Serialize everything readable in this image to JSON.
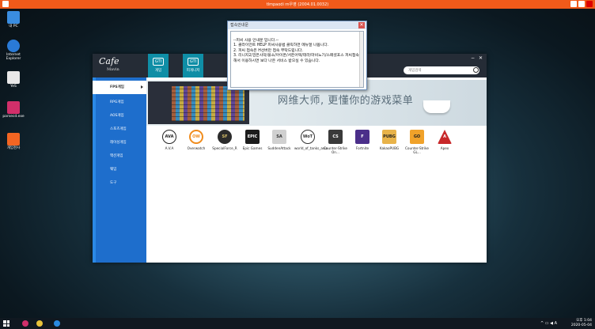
{
  "window_title": "tlmpaodi rn우영 (2004.01.0032)",
  "desktop": {
    "icons": [
      {
        "label": "내 PC",
        "color": "#3a8de0"
      },
      {
        "label": "Internet Explorer",
        "color": "#2a7ad6"
      },
      {
        "label": "YeS",
        "color": "#e8e8e8"
      },
      {
        "label": "parsecd.exe",
        "color": "#d12f6a"
      },
      {
        "label": "개임천사",
        "color": "#f26522"
      }
    ]
  },
  "app": {
    "logo_main": "Cafe",
    "logo_sub": "Mavin",
    "tabs": [
      {
        "icon": "GTI",
        "label": "게임"
      },
      {
        "icon": "GTI",
        "label": "피게니저"
      }
    ],
    "search_placeholder": "게임검색",
    "sidebar": [
      {
        "label": "FPS게임",
        "active": true
      },
      {
        "label": "RPG게임",
        "active": false
      },
      {
        "label": "AOS게임",
        "active": false
      },
      {
        "label": "스포츠게임",
        "active": false
      },
      {
        "label": "레이싱게임",
        "active": false
      },
      {
        "label": "액션게임",
        "active": false
      },
      {
        "label": "웨임",
        "active": false
      },
      {
        "label": "도구",
        "active": false
      }
    ],
    "banner_text": "网维大师, 更懂你的游戏菜单",
    "games": [
      {
        "label": "A.V.A",
        "icon_text": "AVA",
        "color": "#ffffff",
        "fg": "#222"
      },
      {
        "label": "Overwatch",
        "icon_text": "OW",
        "color": "#ffffff",
        "fg": "#f08c1d"
      },
      {
        "label": "SpecialForce_R",
        "icon_text": "SF",
        "color": "#2b2b2b",
        "fg": "#d8c16a"
      },
      {
        "label": "Epic Games",
        "icon_text": "EPIC",
        "color": "#1c1c1c",
        "fg": "#fff"
      },
      {
        "label": "SuddenAttack",
        "icon_text": "SA",
        "color": "#d0d0d0",
        "fg": "#333"
      },
      {
        "label": "world_of_tanks_asia",
        "icon_text": "WoT",
        "color": "#ffffff",
        "fg": "#333"
      },
      {
        "label": "Counter-Strike On...",
        "icon_text": "CS",
        "color": "#3a3a3a",
        "fg": "#fff"
      },
      {
        "label": "Fortnite",
        "icon_text": "F",
        "color": "#4b2f8a",
        "fg": "#fff"
      },
      {
        "label": "KakaoPUBG",
        "icon_text": "PUBG",
        "color": "#e8b34a",
        "fg": "#222"
      },
      {
        "label": "Counter-Strike GL...",
        "icon_text": "GO",
        "color": "#f0a22a",
        "fg": "#222"
      },
      {
        "label": "Apex",
        "icon_text": "A",
        "color": "#c8282a",
        "fg": "#fff"
      }
    ]
  },
  "dialog": {
    "title": "접속안내문",
    "close": "✕",
    "body": "--피씨 사용 안내문 입니다.--\n1. 클라이언트 HELP 피씨사용법 클릭하면 메뉴얼 나옵니다.\n2. 피씨 접속은 H선버만 접속 부탁드립니다.\n3. 리니지2/검은사막/블소/아이온/서든어택/테라/마비노기/스페셜포스 피씨접속해서 이용하시면 보다 나은 서비스 받으실 수 있습니다."
  },
  "taskbar": {
    "time": "오후 1:04",
    "date": "2020-05-04",
    "ime": "A"
  }
}
